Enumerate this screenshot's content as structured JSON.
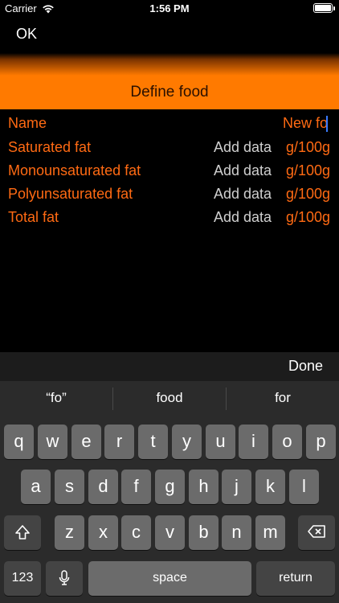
{
  "status_bar": {
    "carrier": "Carrier",
    "time": "1:56 PM",
    "wifi_icon": "wifi-icon",
    "battery_icon": "battery-icon"
  },
  "nav": {
    "ok_label": "OK"
  },
  "header": {
    "title": "Define food"
  },
  "form": {
    "name": {
      "label": "Name",
      "value": "New fo"
    },
    "rows": [
      {
        "label": "Saturated fat",
        "placeholder": "Add data",
        "unit": "g/100g"
      },
      {
        "label": "Monounsaturated fat",
        "placeholder": "Add data",
        "unit": "g/100g"
      },
      {
        "label": "Polyunsaturated fat",
        "placeholder": "Add data",
        "unit": "g/100g"
      },
      {
        "label": "Total fat",
        "placeholder": "Add data",
        "unit": "g/100g"
      }
    ]
  },
  "keyboard": {
    "done_label": "Done",
    "suggestions": [
      "“fo”",
      "food",
      "for"
    ],
    "row1": [
      "q",
      "w",
      "e",
      "r",
      "t",
      "y",
      "u",
      "i",
      "o",
      "p"
    ],
    "row2": [
      "a",
      "s",
      "d",
      "f",
      "g",
      "h",
      "j",
      "k",
      "l"
    ],
    "row3": [
      "z",
      "x",
      "c",
      "v",
      "b",
      "n",
      "m"
    ],
    "numbers_label": "123",
    "space_label": "space",
    "return_label": "return",
    "shift_icon": "shift-icon",
    "mic_icon": "microphone-icon",
    "delete_icon": "delete-icon"
  },
  "colors": {
    "accent": "#ff6a13",
    "header": "#ff7a00",
    "background": "#000000",
    "key": "#6b6b6b"
  }
}
